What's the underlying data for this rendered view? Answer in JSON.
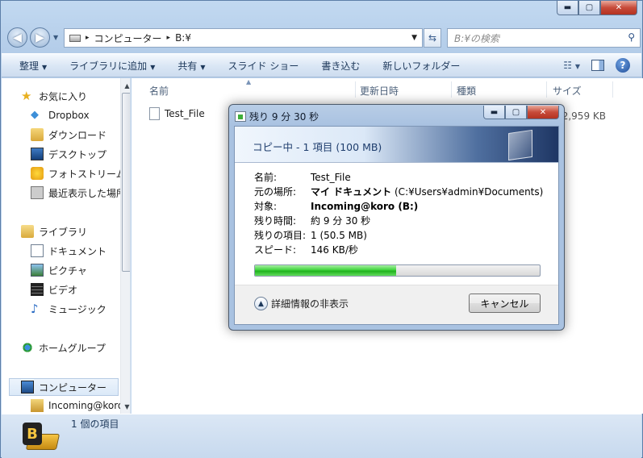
{
  "caption": {
    "min": "▬",
    "max": "▢",
    "close": "✕"
  },
  "address": {
    "seg1": "コンピューター",
    "seg2": "B:¥",
    "sep": "▸"
  },
  "search": {
    "placeholder": "B:¥の検索"
  },
  "toolbar": {
    "items": [
      "整理",
      "ライブラリに追加",
      "共有",
      "スライド ショー",
      "書き込む",
      "新しいフォルダー"
    ],
    "help": "?"
  },
  "nav": {
    "favorites_header": "お気に入り",
    "favorites": [
      "Dropbox",
      "ダウンロード",
      "デスクトップ",
      "フォトストリーム",
      "最近表示した場所"
    ],
    "libraries_header": "ライブラリ",
    "libraries": [
      "ドキュメント",
      "ピクチャ",
      "ビデオ",
      "ミュージック"
    ],
    "homegroup": "ホームグループ",
    "computer": "コンピューター",
    "drive": "Incoming@koro"
  },
  "columns": {
    "name": "名前",
    "date": "更新日時",
    "type": "種類",
    "size": "サイズ"
  },
  "file": {
    "name": "Test_File",
    "size": "2,959 KB"
  },
  "status": {
    "items": "1 個の項目",
    "drive_letter": "B"
  },
  "dialog": {
    "title": "残り 9 分 30 秒",
    "header": "コピー中 - 1 項目 (100 MB)",
    "labels": {
      "name": "名前:",
      "from": "元の場所:",
      "to": "対象:",
      "time": "残り時間:",
      "items": "残りの項目:",
      "speed": "スピード:"
    },
    "values": {
      "name": "Test_File",
      "from_bold": "マイ ドキュメント",
      "from_path": " (C:¥Users¥admin¥Documents)",
      "to": "Incoming@koro (B:)",
      "time": "約 9 分 30 秒",
      "items": "1 (50.5 MB)",
      "speed": "146 KB/秒"
    },
    "progress": 0.495,
    "details": "詳細情報の非表示",
    "cancel": "キャンセル"
  },
  "colors": {
    "progress": "#2fc42c",
    "accent": "#1e395b"
  }
}
